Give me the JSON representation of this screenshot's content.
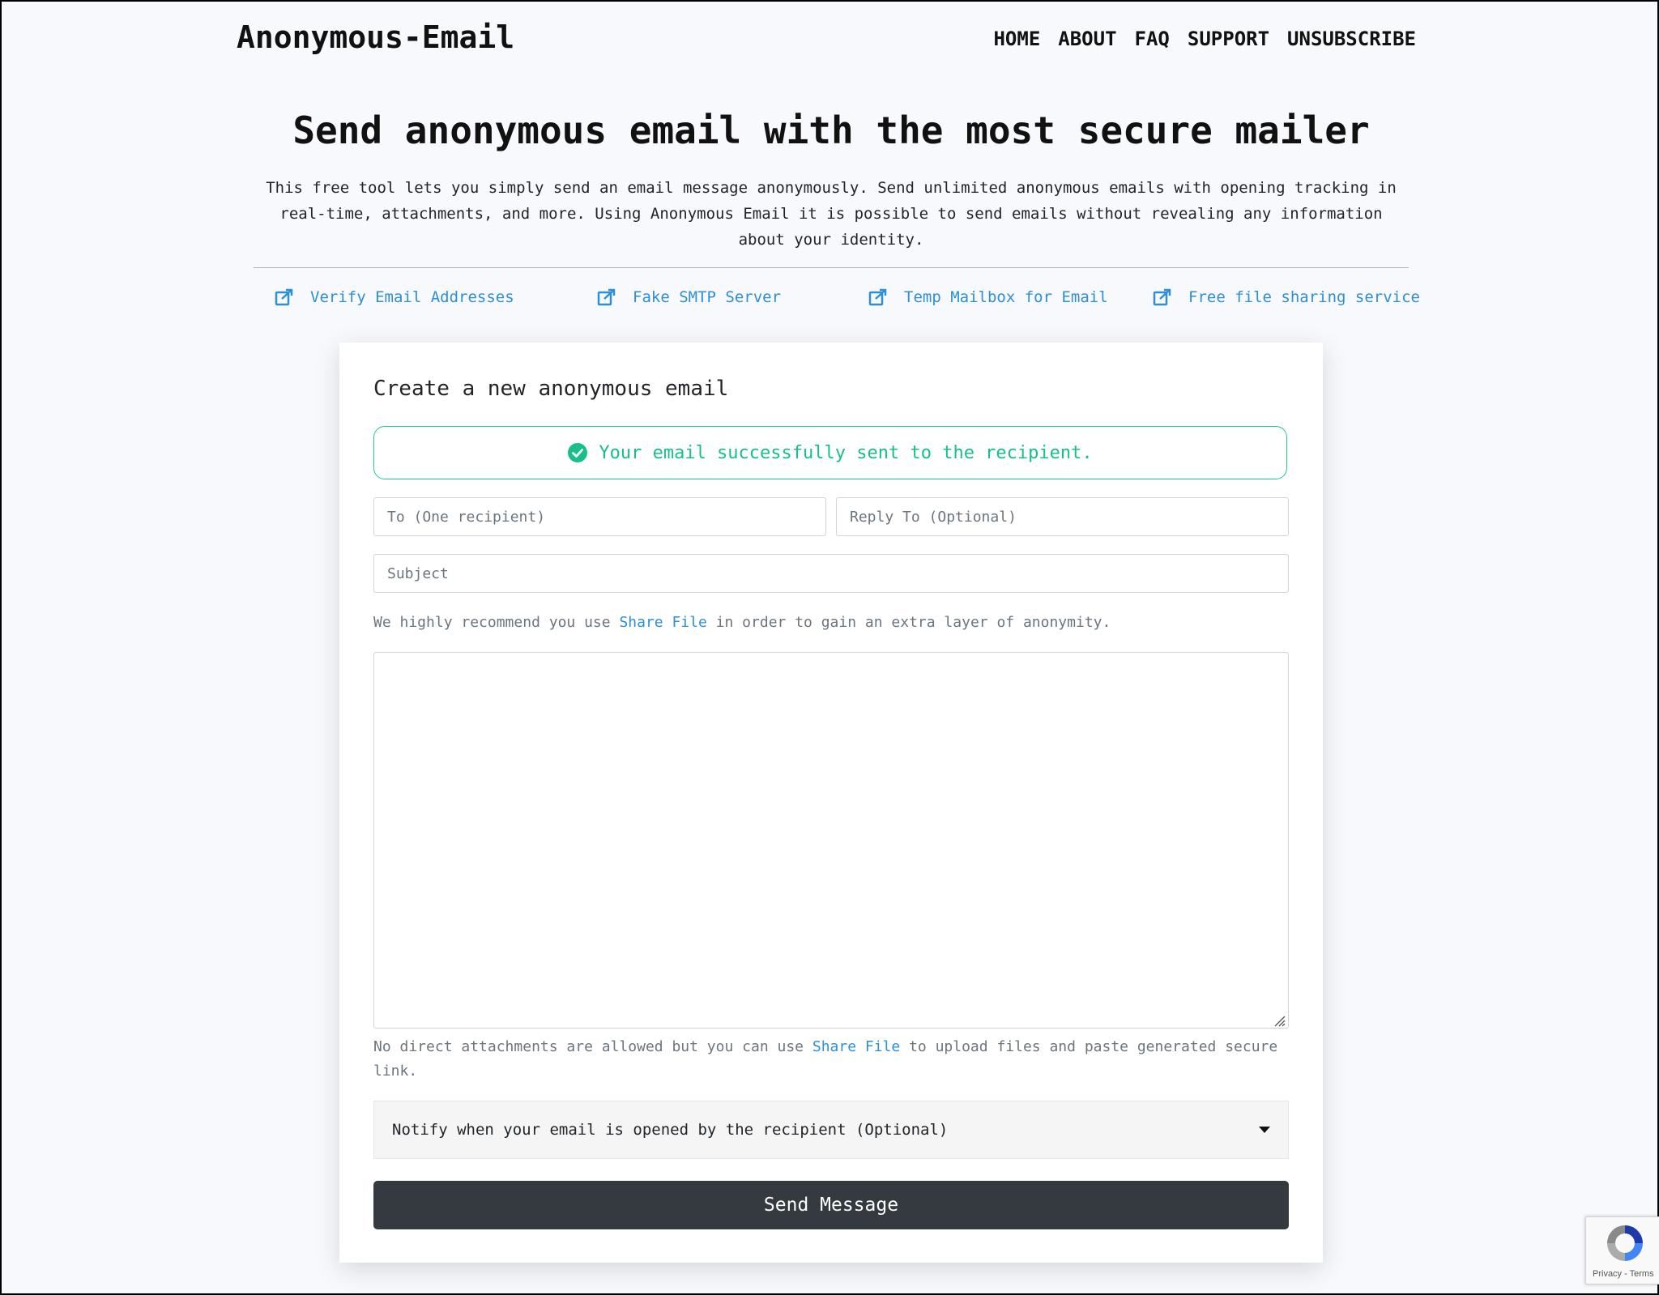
{
  "header": {
    "logo": "Anonymous-Email",
    "nav": [
      "HOME",
      "ABOUT",
      "FAQ",
      "SUPPORT",
      "UNSUBSCRIBE"
    ]
  },
  "hero": {
    "title": "Send anonymous email with the most secure mailer",
    "description": "This free tool lets you simply send an email message anonymously. Send unlimited anonymous emails with opening tracking in real-time, attachments, and more. Using Anonymous Email it is possible to send emails without revealing any information about your identity."
  },
  "tools": [
    {
      "label": "Verify Email Addresses",
      "icon": "external-link-icon"
    },
    {
      "label": "Fake SMTP Server",
      "icon": "external-link-icon"
    },
    {
      "label": "Temp Mailbox for Email",
      "icon": "external-link-icon"
    },
    {
      "label": "Free file sharing service",
      "icon": "external-link-icon"
    }
  ],
  "form": {
    "title": "Create a new anonymous email",
    "alert": "Your email successfully sent to the recipient.",
    "to_placeholder": "To (One recipient)",
    "reply_placeholder": "Reply To (Optional)",
    "subject_placeholder": "Subject",
    "hint1_pre": "We highly recommend you use",
    "hint1_link": "Share File",
    "hint1_post": "in order to gain an extra layer of anonymity.",
    "message_value": "",
    "hint2_pre": "No direct attachments are allowed but you can use",
    "hint2_link": "Share File",
    "hint2_post": "to upload files and paste generated secure link.",
    "notify_label": "Notify when your email is opened by the recipient (Optional)",
    "send_label": "Send Message"
  },
  "recaptcha": {
    "text": "Privacy - Terms"
  },
  "colors": {
    "accent": "#2d8fd8",
    "success": "#17c08b",
    "button": "#343a40"
  }
}
